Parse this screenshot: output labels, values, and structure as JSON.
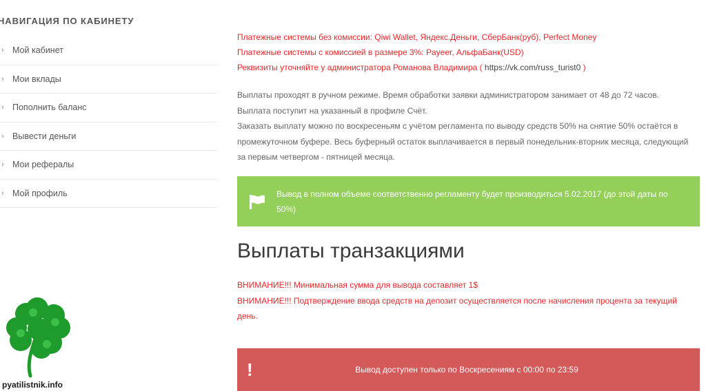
{
  "sidebar": {
    "title": "Навигация по кабинету",
    "items": [
      {
        "label": "Мой кабинет"
      },
      {
        "label": "Мои вклады"
      },
      {
        "label": "Пополнить баланс"
      },
      {
        "label": "Вывести деньги"
      },
      {
        "label": "Мои рефералы"
      },
      {
        "label": "Мой профиль"
      }
    ]
  },
  "logo": {
    "text": "pyatilistnik.info",
    "icon": "four-leaf-clover-icon",
    "color": "#1e9b2b"
  },
  "payments": {
    "line1": "Платежные системы без комиссии: Qiwi Wallet, Яндекс.Деньги, СберБанк(руб), Perfect Money",
    "line2": "Платежные системы с комиссией в размере 3%: Payeer, АльфаБанк(USD)",
    "line3_prefix": "Реквизиты уточняйте у администратора Романова Владимира (",
    "line3_link": " https://vk.com/russ_turist0 ",
    "line3_suffix": ")"
  },
  "info": {
    "line1": "Выплаты проходят в ручном режиме. Время обработки заявки администратором занимает от 48 до 72 часов.",
    "line2": "Выплата поступит на указанный в профиле Счёт.",
    "line3": "Заказать выплату можно по воскресеньям с учётом регламента по выводу средств 50% на снятие 50% остаётся в промежуточном буфере. Весь буферный остаток выплачивается в первый понедельник-вторник месяца, следующий за первым четвергом - пятницей месяца."
  },
  "green_notice": {
    "icon": "flag-icon",
    "text": "Вывод в полном объеме соответственно регламенту будет производиться 5.02.2017 (до этой даты по 50%)",
    "color": "#94cf5a"
  },
  "heading": "Выплаты транзакциями",
  "warnings": {
    "line1": "ВНИМАНИЕ!!! Минимальная сумма для вывода составляет 1$",
    "line2": "ВНИМАНИЕ!!! Подтверждение ввода средств на депозит осуществляется после начисления процента за текущий день."
  },
  "red_notice": {
    "icon": "exclamation-icon",
    "text": "Вывод доступен только по Воскресениям с 00:00 по 23:59",
    "color": "#d45a5a"
  },
  "colors": {
    "accent_red": "#e8262a",
    "text_gray": "#666666"
  }
}
